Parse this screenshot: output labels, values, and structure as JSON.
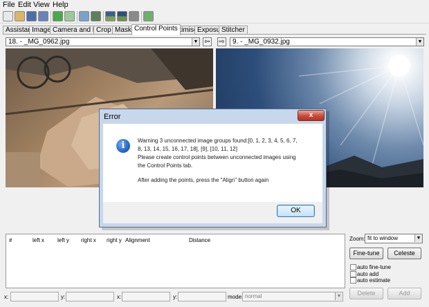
{
  "menu": [
    "File",
    "Edit",
    "View",
    "Help"
  ],
  "tabs": [
    "Assistant",
    "Images",
    "Camera and Lens",
    "Crop",
    "Mask",
    "Control Points",
    "Optimiser",
    "Exposure",
    "Stitcher"
  ],
  "active_tab": "Control Points",
  "left_image_select": "18. - _MG_0962.jpg",
  "right_image_select": "9. - _MG_0932.jpg",
  "nav_left_glyph": "⇦",
  "nav_right_glyph": "⇨",
  "table_headers": [
    "#",
    "left x",
    "left y",
    "right x",
    "right y",
    "Alignment",
    "Distance"
  ],
  "zoom": {
    "label": "Zoom:",
    "value": "fit to window"
  },
  "buttons": {
    "fine_tune": "Fine-tune",
    "celeste": "Celeste",
    "delete": "Delete",
    "add": "Add"
  },
  "checkboxes": [
    "auto fine-tune",
    "auto add",
    "auto estimate"
  ],
  "coords": {
    "x_label": "x:",
    "y_label": "y:",
    "mode_label": "mode:",
    "mode_value": "normal"
  },
  "dialog": {
    "title": "Error",
    "close_glyph": "x",
    "icon_glyph": "i",
    "lines": [
      "Warning 3 unconnected image groups found:[0, 1, 2, 3, 4, 5, 6, 7,",
      "8, 13, 14, 15, 16, 17, 18], [9], [10, 11, 12]",
      "Please create control points between unconnected images using",
      "the Control Points tab.",
      "After adding the points, press the \"Align\" button again"
    ],
    "ok": "OK"
  },
  "colors": {
    "dialog_frame": "#c7d7ec",
    "close_button": "#c9493a",
    "ok_border": "#3c7fb1"
  }
}
